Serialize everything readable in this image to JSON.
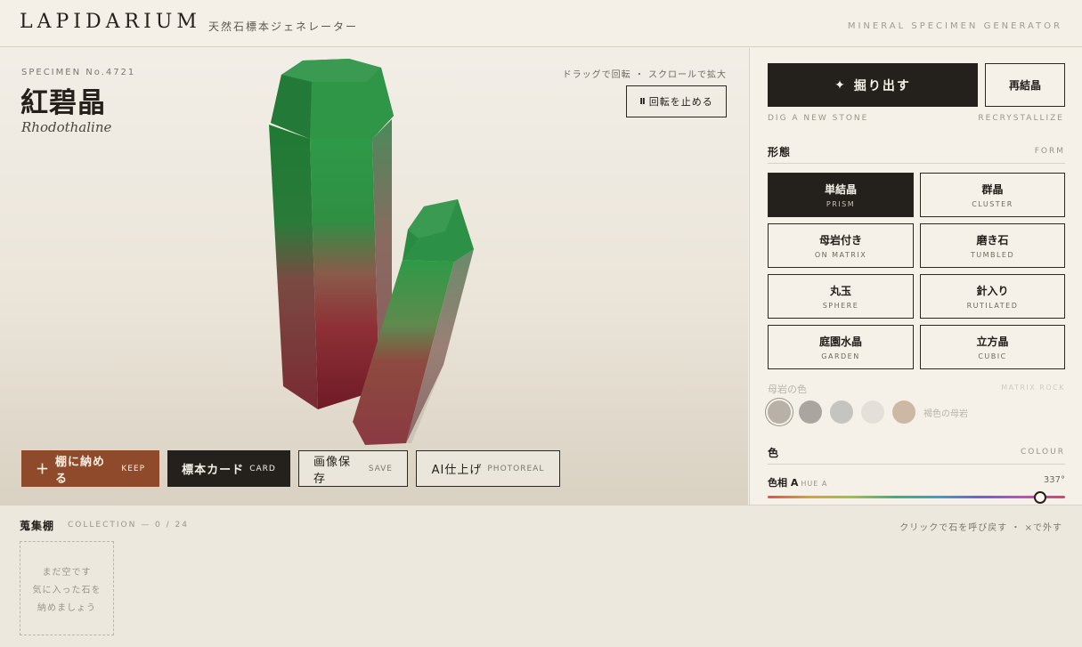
{
  "header": {
    "logo": "LAPIDARIUM",
    "subtitle": "天然石標本ジェネレーター",
    "right_label": "MINERAL SPECIMEN GENERATOR"
  },
  "specimen": {
    "number": "SPECIMEN No.4721",
    "name": "紅碧晶",
    "latin": "Rhodothaline"
  },
  "stage": {
    "hint": "ドラッグで回転 ・ スクロールで拡大",
    "pause_icon": "pause-icon",
    "pause_glyph": "II",
    "pause_label": "回転を止める"
  },
  "actions": {
    "keep_icon": "plus-icon",
    "keep_glyph": "＋",
    "keep_label": "棚に納める",
    "keep_en": "KEEP",
    "card_label": "標本カード",
    "card_en": "CARD",
    "save_label": "画像保存",
    "save_en": "SAVE",
    "ai_label": "AI仕上げ",
    "ai_en": "PHOTOREAL"
  },
  "panel": {
    "dig_icon": "sparkle-icon",
    "dig_glyph": "✦",
    "dig_label": "掘り出す",
    "recry_label": "再結晶",
    "dig_caption": "DIG A NEW STONE",
    "recry_caption": "RECRYSTALLIZE",
    "form_title": "形態",
    "form_title_en": "FORM",
    "forms": [
      {
        "jp": "単結晶",
        "en": "PRISM",
        "active": true
      },
      {
        "jp": "群晶",
        "en": "CLUSTER",
        "active": false
      },
      {
        "jp": "母岩付き",
        "en": "ON MATRIX",
        "active": false
      },
      {
        "jp": "磨き石",
        "en": "TUMBLED",
        "active": false
      },
      {
        "jp": "丸玉",
        "en": "SPHERE",
        "active": false
      },
      {
        "jp": "針入り",
        "en": "RUTILATED",
        "active": false
      },
      {
        "jp": "庭園水晶",
        "en": "GARDEN",
        "active": false
      },
      {
        "jp": "立方晶",
        "en": "CUBIC",
        "active": false
      }
    ],
    "matrix_title": "母岩の色",
    "matrix_title_en": "MATRIX ROCK",
    "matrix_swatches": [
      "#b8b1a8",
      "#a9a6a0",
      "#c6c4bf",
      "#e3e0da",
      "#cdb8a6"
    ],
    "matrix_label": "褐色の母岩",
    "colour_title": "色",
    "colour_title_en": "COLOUR",
    "hue_label": "色相 A",
    "hue_label_en": "HUE A",
    "hue_value": "337°",
    "hue_fraction": 0.916
  },
  "collection": {
    "title": "蒐集棚",
    "count": "COLLECTION — 0 / 24",
    "hint": "クリックで石を呼び戻す ・ ×で外す",
    "empty_line1": "まだ空です",
    "empty_line2": "気に入った石を",
    "empty_line3": "納めましょう"
  },
  "colors": {
    "accent_dark": "#24211c",
    "keep_brown": "#8f4a2b",
    "crystal_green": "#1f8a3c",
    "crystal_red": "#7a1f2b"
  }
}
